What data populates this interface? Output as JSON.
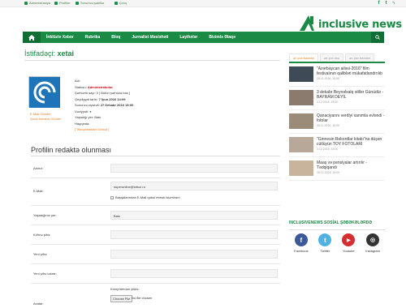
{
  "topbar": {
    "links": [
      "Administrasiya",
      "Profilim",
      "Sonuncu şəkillər",
      "Çıxış"
    ],
    "social": [
      "f",
      "t",
      "rss"
    ]
  },
  "header": {
    "logo": "inclusive news"
  },
  "nav": {
    "items": [
      "İnklüziv Xəbər",
      "Rubrika",
      "Bloq",
      "Jurnalist Məsləhəti",
      "Layihələr",
      "Bizimlə Əlaqə"
    ]
  },
  "profile": {
    "title_prefix": "İstifadəçi:",
    "username": "xetai",
    "email_link": "E-Mail Gönder",
    "pm_link": "Şəxsi İsmarış Gönder",
    "fields": [
      {
        "label": "Adı:",
        "value": ""
      },
      {
        "label": "Statusu:",
        "value": "Administratorlar"
      },
      {
        "label": "Şərhlərin sayı:",
        "value": "0 [ Bütün şərhlərə bax ]"
      },
      {
        "label": "Qeydiyyat tarixi:",
        "value": "7 İyun 2016 14:09"
      },
      {
        "label": "Sonuncu ziyarəti:",
        "value": "27 Dekabr 2016 15:00"
      },
      {
        "label": "Vəziyyəti:",
        "value": ""
      },
      {
        "label": "Yaşadığı yer:",
        "value": "Bakı"
      },
      {
        "label": "Haqqında:",
        "value": ""
      },
      {
        "label": "",
        "value": "[ Əlaqəndakları Göstər ]"
      }
    ]
  },
  "edit": {
    "title": "Profilin redaktə olunması",
    "rows": [
      {
        "label": "Adınız:",
        "value": ""
      },
      {
        "label": "E-Mail:",
        "value": "superonline@inbox.ru",
        "checkbox": "Başqalarından E-Mail qəbul etmək istəmirəm"
      },
      {
        "label": "Yaşadığınız yer:",
        "value": "Bakı"
      },
      {
        "label": "Köhnə şifrə:",
        "value": ""
      },
      {
        "label": "Yeni şifrə:",
        "value": ""
      },
      {
        "label": "Yeni şifrə təkrar:",
        "value": ""
      },
      {
        "label": "Avatar:",
        "file_caption": "Kompüterdən yüklə:",
        "file_button": "Choose File",
        "file_status": "No file chosen"
      }
    ]
  },
  "sidebar": {
    "tabs": [
      "ən çox baxılan",
      "ən çox oxu",
      "ən çox baxılan"
    ],
    "news": [
      {
        "title": "\"Azərbaycan ailəsi-2016\" film festivalının qalibləri mükafatlandırılıb",
        "date": "28.11.2016, 15:55"
      },
      {
        "title": "3 dekabr Beynəlxalq əlillər Günüdür - BAYRAM DEYİL",
        "date": "3.12.2016, 15:00"
      },
      {
        "title": "Qanaciyarını verdiyi xanımla evləndi - fotolar",
        "date": "28.11.2016, 15:00"
      },
      {
        "title": "\"Ginnesin Rekordlar kitabı\"na düşən cütlüyün TOY FOTOLARI",
        "date": "3.12.2016, 15:00"
      },
      {
        "title": "Maaş və pensiyalar artırılır - Tədqiqandı",
        "date": "26.12.2016, 15:00"
      }
    ],
    "social_title": "INCLUSIVENEWS SOSİAL ŞƏBƏKƏLƏRDƏ",
    "social": [
      {
        "name": "Facebook",
        "glyph": "f",
        "color": "#3b5998"
      },
      {
        "name": "Twitter",
        "glyph": "t",
        "color": "#4fb2e3"
      },
      {
        "name": "Youtube",
        "glyph": "▶",
        "color": "#d62e2e"
      },
      {
        "name": "Instagram",
        "glyph": "◎",
        "color": "#333333"
      }
    ]
  },
  "colors": {
    "brand": "#1a8a45",
    "accent": "#e67e22",
    "status": "#d0021b"
  }
}
